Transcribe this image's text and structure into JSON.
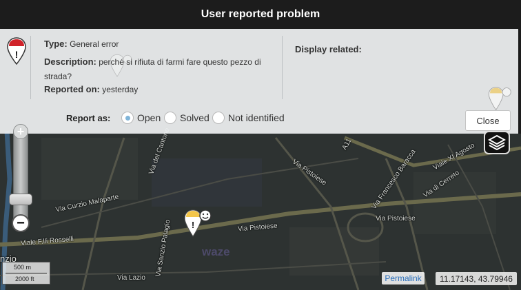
{
  "dialog": {
    "title": "User reported problem",
    "type_label": "Type:",
    "type_value": "General error",
    "description_label": "Description:",
    "description_value": "perché si rifiuta di farmi fare questo pezzo di strada?",
    "reported_label": "Reported on:",
    "reported_value": "yesterday",
    "display_related": "Display related:",
    "report_as_label": "Report as:",
    "options": [
      {
        "label": "Open",
        "checked": true
      },
      {
        "label": "Solved",
        "checked": false
      },
      {
        "label": "Not identified",
        "checked": false
      }
    ],
    "close_label": "Close"
  },
  "map": {
    "streets": [
      "Via del Cantone",
      "Via Pistoiese",
      "Viale F.lli Rosselli",
      "Via Francesco Baracca",
      "Viale XI Agosto",
      "Via di Cerreto",
      "Via Curzio Malaparte",
      "Via Pistoiese",
      "Via Lazio",
      "Via Pistoiese",
      "A11",
      "Via Sanzio Palagio"
    ],
    "city_label": "nzio",
    "watermark": "waze",
    "scale_metric": "500 m",
    "scale_imperial": "2000 ft",
    "permalink_label": "Permalink",
    "coordinates": "11.17143, 43.79946"
  },
  "icons": [
    "problem-marker-icon",
    "smiley-icon",
    "layers-icon",
    "zoom-in-icon",
    "zoom-out-icon"
  ],
  "colors": {
    "title_bar": "#1c1c1c",
    "panel": "#eef0f1",
    "map_bg": "#2d3231",
    "radio_accent": "#7fb4d8",
    "marker_red": "#d0232a",
    "marker_yellow": "#f3c64b"
  }
}
